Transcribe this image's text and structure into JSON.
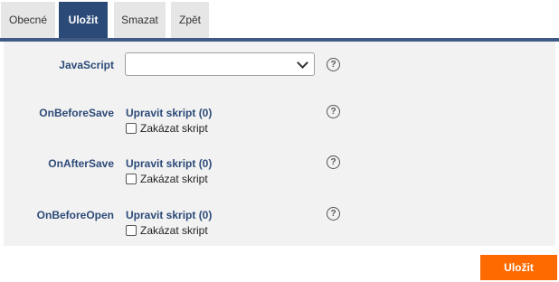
{
  "tabs": [
    {
      "label": "Obecné",
      "active": false
    },
    {
      "label": "Uložit",
      "active": true
    },
    {
      "label": "Smazat",
      "active": false
    },
    {
      "label": "Zpět",
      "active": false
    }
  ],
  "form": {
    "javascript_label": "JavaScript",
    "javascript_value": "",
    "help_glyph": "?",
    "events": [
      {
        "label": "OnBeforeSave",
        "edit": "Upravit skript (0)",
        "disable": "Zakázat skript",
        "checked": false
      },
      {
        "label": "OnAfterSave",
        "edit": "Upravit skript (0)",
        "disable": "Zakázat skript",
        "checked": false
      },
      {
        "label": "OnBeforeOpen",
        "edit": "Upravit skript (0)",
        "disable": "Zakázat skript",
        "checked": false
      }
    ]
  },
  "footer": {
    "save_label": "Uložit"
  },
  "colors": {
    "accent": "#2c4a78",
    "save": "#ff6a00",
    "panel_bg": "#f2f2f2"
  },
  "icons": {
    "help": "question-circle-icon",
    "dropdown": "chevron-down-icon"
  }
}
